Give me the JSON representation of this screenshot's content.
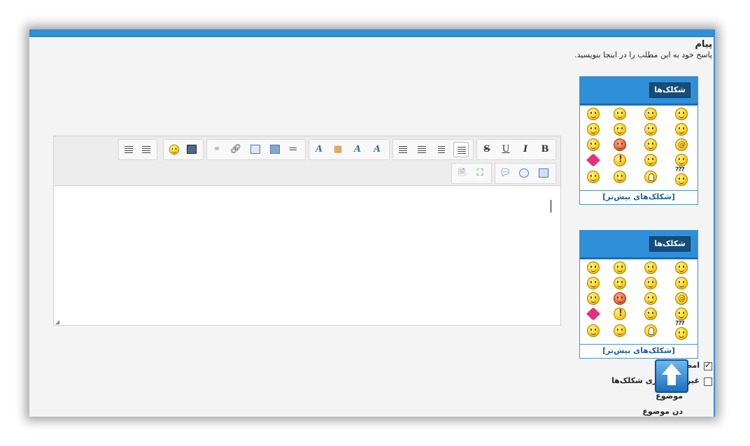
{
  "message": {
    "title": "پیام",
    "subtitle": "پاسخ خود به این مطلب را در اینجا بنویسید."
  },
  "smiley_panels": [
    {
      "title": "شکلک‌ها",
      "more_link": "[شکلک‌های بیش‌تر]"
    },
    {
      "title": "شکلک‌ها",
      "more_link": "[شکلک‌های بیش‌تر]"
    }
  ],
  "smiley_extra_label": "???",
  "options": {
    "signature_label": "امضا",
    "signature_checked": true,
    "disable_smilies_label": "غیرفعال‌سازی شکلک‌ها",
    "disable_smilies_checked": false,
    "subject_label": "موضوع",
    "subject_label_2": "دن موضوع"
  },
  "toolbar": {
    "bold": "B",
    "italic": "I",
    "underline": "U",
    "strike": "S",
    "font_label": "A"
  },
  "colors": {
    "accent": "#2f8fd8",
    "accent_dark": "#174d7a",
    "link": "#1b5fa6"
  }
}
